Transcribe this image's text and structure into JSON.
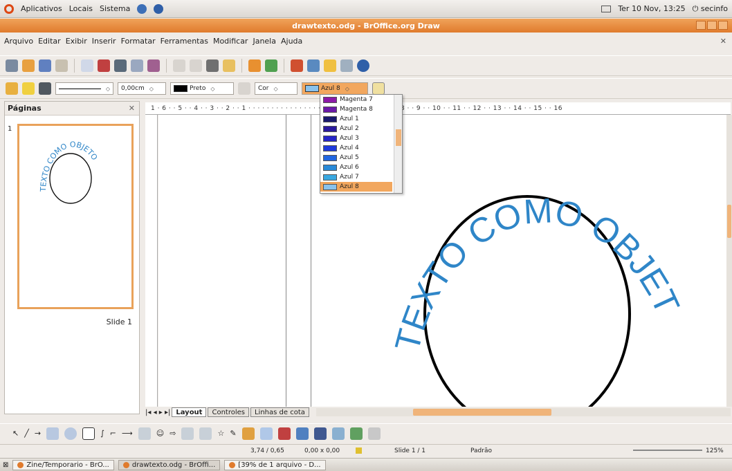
{
  "topbar": {
    "apps": "Aplicativos",
    "places": "Locais",
    "system": "Sistema",
    "datetime": "Ter 10 Nov, 13:25",
    "user": "secinfo"
  },
  "window": {
    "title": "drawtexto.odg - BrOffice.org Draw"
  },
  "menubar": [
    "Arquivo",
    "Editar",
    "Exibir",
    "Inserir",
    "Formatar",
    "Ferramentas",
    "Modificar",
    "Janela",
    "Ajuda"
  ],
  "line_toolbar": {
    "line_width": "0,00cm",
    "line_color": "Preto",
    "area_style": "Cor",
    "area_color": "Azul 8"
  },
  "colors": {
    "accent": "#e07b2d",
    "text_art": "#2f86c8"
  },
  "color_dropdown": {
    "items": [
      {
        "label": "Magenta 7",
        "color": "#8c1aa8"
      },
      {
        "label": "Magenta 8",
        "color": "#6b1aa8"
      },
      {
        "label": "Azul 1",
        "color": "#1a1a6e"
      },
      {
        "label": "Azul 2",
        "color": "#2a1a9e"
      },
      {
        "label": "Azul 3",
        "color": "#2626c8"
      },
      {
        "label": "Azul 4",
        "color": "#1e3adc"
      },
      {
        "label": "Azul 5",
        "color": "#2166e0"
      },
      {
        "label": "Azul 6",
        "color": "#2a8ad8"
      },
      {
        "label": "Azul 7",
        "color": "#3aa8e0"
      },
      {
        "label": "Azul 8",
        "color": "#8ac2ec"
      }
    ],
    "selected": "Azul 8"
  },
  "panel": {
    "title": "Páginas",
    "slide_number": "1",
    "slide_label": "Slide 1"
  },
  "ruler": "1 · 6 · · 5 · · 4 · · 3 · · 2 · · 1 · · · · · · · · · · · · · · · · · · · 4 · · 5 · · 6 · · 7 · · 8 · · 9 · · 10 · · 11 · · 12 · · 13 · · 14 · · 15 · · 16",
  "artwork": {
    "text": "TEXTO COMO OBJETO"
  },
  "tabs": [
    "Layout",
    "Controles",
    "Linhas de cota"
  ],
  "statusbar": {
    "position": "3,74 / 0,65",
    "size": "0,00 x 0,00",
    "slide": "Slide 1 / 1",
    "style": "Padrão",
    "zoom": "125%"
  },
  "taskbar": [
    {
      "label": "Zine/Temporario - BrO...",
      "color": "#e07b2d"
    },
    {
      "label": "drawtexto.odg - BrOffi...",
      "color": "#e07b2d"
    },
    {
      "label": "[39% de 1 arquivo - D...",
      "color": "#e07b2d"
    }
  ]
}
